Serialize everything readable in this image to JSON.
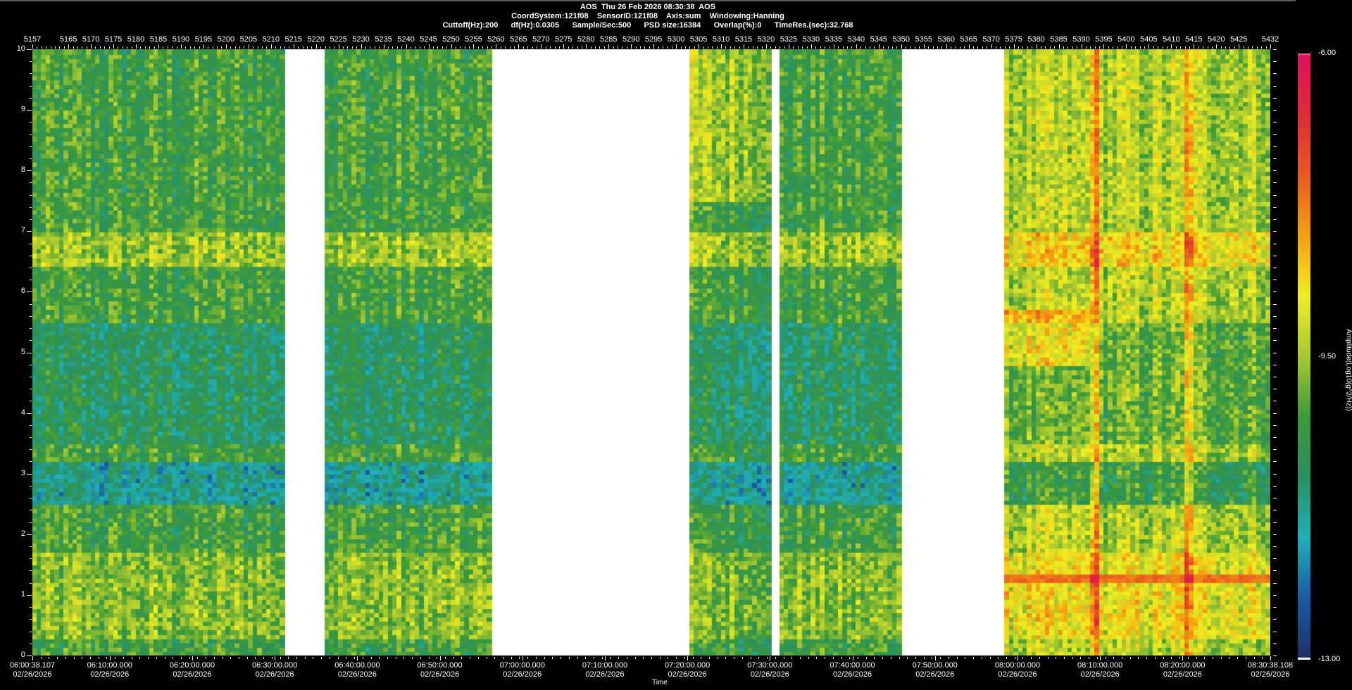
{
  "header": {
    "line1": "AOS  Thu 26 Feb 2026 08:30:38  AOS",
    "line2": "CoordSystem:121f08    SensorID:121f08    Axis:sum    Windowing:Hanning",
    "line3": "Cuttoff(Hz):200      df(Hz):0.0305      Sample/Sec:500      PSD size:16384      Overlap(%):0      TimeRes.(sec):32.768"
  },
  "chart_data": {
    "type": "heatmap",
    "title": "AOS  Thu 26 Feb 2026 08:30:38  AOS",
    "xlabel": "Time",
    "ylabel": "",
    "colorbar_label": "Amplitude(Log10(g^2/Hz))",
    "colorbar_ticks": [
      "-6.00",
      "-9.50",
      "-13.00"
    ],
    "color_range": [
      -13.0,
      -6.0
    ],
    "colormap": [
      "#1e2f66",
      "#1a5aa0",
      "#1fb0b8",
      "#2a9060",
      "#3c9a3a",
      "#a8c830",
      "#f0ee20",
      "#f5a010",
      "#e85a20",
      "#e02a38",
      "#e0105a"
    ],
    "ylim": [
      0,
      10
    ],
    "y_ticks": [
      "0",
      "1",
      "2",
      "3",
      "4",
      "5",
      "6",
      "7",
      "8",
      "9",
      "10"
    ],
    "time_range_min": [
      0,
      150
    ],
    "time_start": "06:00:38.107",
    "x_ticks": [
      {
        "t": 0,
        "time": "06:00:38.107",
        "date": "02/26/2026"
      },
      {
        "t": 9.365,
        "time": "06:10:00.000",
        "date": "02/26/2026"
      },
      {
        "t": 19.365,
        "time": "06:20:00.000",
        "date": "02/26/2026"
      },
      {
        "t": 29.365,
        "time": "06:30:00.000",
        "date": "02/26/2026"
      },
      {
        "t": 39.365,
        "time": "06:40:00.000",
        "date": "02/26/2026"
      },
      {
        "t": 49.365,
        "time": "06:50:00.000",
        "date": "02/26/2026"
      },
      {
        "t": 59.365,
        "time": "07:00:00.000",
        "date": "02/26/2026"
      },
      {
        "t": 69.365,
        "time": "07:10:00.000",
        "date": "02/26/2026"
      },
      {
        "t": 79.365,
        "time": "07:20:00.000",
        "date": "02/26/2026"
      },
      {
        "t": 89.365,
        "time": "07:30:00.000",
        "date": "02/26/2026"
      },
      {
        "t": 99.365,
        "time": "07:40:00.000",
        "date": "02/26/2026"
      },
      {
        "t": 109.365,
        "time": "07:50:00.000",
        "date": "02/26/2026"
      },
      {
        "t": 119.365,
        "time": "08:00:00.000",
        "date": "02/26/2026"
      },
      {
        "t": 129.365,
        "time": "08:10:00.000",
        "date": "02/26/2026"
      },
      {
        "t": 139.365,
        "time": "08:20:00.000",
        "date": "02/26/2026"
      },
      {
        "t": 150,
        "time": "08:30:38.108",
        "date": "02/26/2026"
      }
    ],
    "index_range": [
      5157,
      5432
    ],
    "top_ticks": [
      "5157",
      "5165",
      "5170",
      "5175",
      "5180",
      "5185",
      "5190",
      "5195",
      "5200",
      "5205",
      "5210",
      "5215",
      "5220",
      "5225",
      "5230",
      "5235",
      "5240",
      "5245",
      "5250",
      "5255",
      "5260",
      "5265",
      "5270",
      "5275",
      "5280",
      "5285",
      "5290",
      "5295",
      "5300",
      "5305",
      "5310",
      "5315",
      "5320",
      "5325",
      "5330",
      "5335",
      "5340",
      "5345",
      "5350",
      "5355",
      "5360",
      "5365",
      "5370",
      "5375",
      "5380",
      "5385",
      "5390",
      "5395",
      "5400",
      "5405",
      "5410",
      "5415",
      "5420",
      "5425",
      "5432"
    ],
    "gaps_min": [
      [
        30.8,
        35.2
      ],
      [
        55.4,
        79.4
      ],
      [
        89.3,
        90.4
      ],
      [
        105.2,
        117.7
      ]
    ],
    "bands": [
      {
        "f": [
          0,
          1.7
        ],
        "level": -9.6
      },
      {
        "f": [
          6.4,
          7.0
        ],
        "level": -9.4
      },
      {
        "f": [
          2.5,
          3.2
        ],
        "level": -11.6
      },
      {
        "f": [
          3.5,
          5.5
        ],
        "level": -11.0
      }
    ],
    "late_features": {
      "line_hz": 1.3,
      "line_level": -7.6,
      "vertical_lines_index": [
        5393,
        5414
      ]
    },
    "base_level": -10.3
  }
}
